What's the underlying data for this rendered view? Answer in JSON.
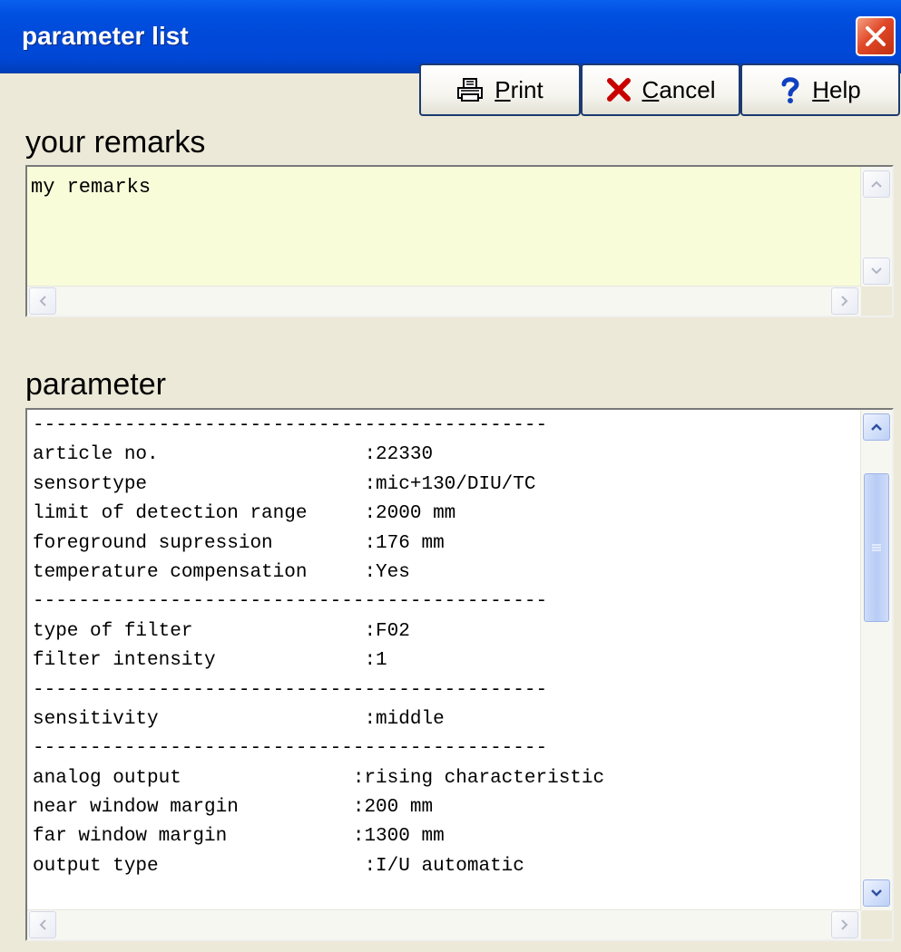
{
  "window": {
    "title": "parameter list"
  },
  "toolbar": {
    "print_label": "Print",
    "print_mnemonic": "P",
    "print_rest": "rint",
    "cancel_mnemonic": "C",
    "cancel_rest": "ancel",
    "help_mnemonic": "H",
    "help_rest": "elp",
    "print_icon": "printer-icon",
    "cancel_icon": "red-x-icon",
    "help_icon": "blue-question-icon"
  },
  "remarks": {
    "label": "your remarks",
    "value": "my remarks",
    "background": "#f8fcd9"
  },
  "parameter": {
    "label": "parameter",
    "lines": [
      "---------------------------------------------",
      "article no.                  :22330",
      "sensortype                   :mic+130/DIU/TC",
      "limit of detection range     :2000 mm",
      "foreground supression        :176 mm",
      "temperature compensation     :Yes",
      "---------------------------------------------",
      "type of filter               :F02",
      "filter intensity             :1",
      "---------------------------------------------",
      "sensitivity                  :middle",
      "---------------------------------------------",
      "analog output               :rising characteristic",
      "near window margin          :200 mm",
      "far window margin           :1300 mm",
      "output type                  :I/U automatic"
    ]
  },
  "colors": {
    "titlebar": "#0049d8",
    "dialog_bg": "#ece9d8",
    "close_button": "#e04828"
  }
}
